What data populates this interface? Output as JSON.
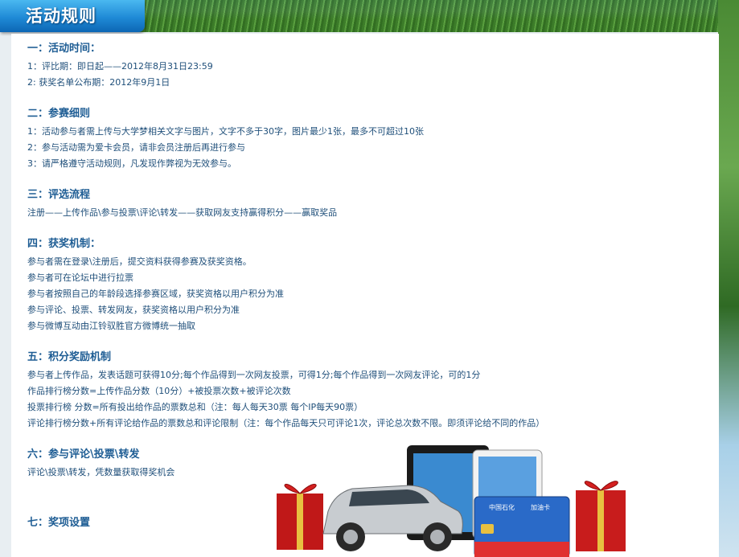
{
  "header": {
    "title": "活动规则"
  },
  "sections": [
    {
      "heading": "一：活动时间：",
      "lines": [
        "1：评比期：即日起——2012年8月31日23:59",
        "2: 获奖名单公布期：2012年9月1日"
      ]
    },
    {
      "heading": "二：参赛细则",
      "lines": [
        "1：活动参与者需上传与大学梦相关文字与图片，文字不多于30字，图片最少1张，最多不可超过10张",
        "2：参与活动需为爱卡会员，请非会员注册后再进行参与",
        "3：请严格遵守活动规则，凡发现作弊视为无效参与。"
      ]
    },
    {
      "heading": "三：评选流程",
      "lines": [
        "注册——上传作品\\参与投票\\评论\\转发——获取网友支持赢得积分——赢取奖品"
      ]
    },
    {
      "heading": "四：获奖机制：",
      "lines": [
        "参与者需在登录\\注册后，提交资料获得参赛及获奖资格。",
        "参与者可在论坛中进行拉票",
        "参与者按照自己的年龄段选择参赛区域，获奖资格以用户积分为准",
        "参与评论、投票、转发网友，获奖资格以用户积分为准",
        "参与微博互动由江铃驭胜官方微博统一抽取"
      ]
    },
    {
      "heading": "五：积分奖励机制",
      "lines": [
        "参与者上传作品，发表话题可获得10分;每个作品得到一次网友投票，可得1分;每个作品得到一次网友评论，可的1分",
        "作品排行榜分数=上传作品分数（10分）+被投票次数+被评论次数",
        "投票排行榜 分数=所有投出给作品的票数总和（注：每人每天30票 每个IP每天90票）",
        "评论排行榜分数+所有评论给作品的票数总和评论限制（注：每个作品每天只可评论1次，评论总次数不限。即须评论给不同的作品）"
      ]
    },
    {
      "heading": "六：参与评论\\投票\\转发",
      "lines": [
        "评论\\投票\\转发，凭数量获取得奖机会"
      ]
    },
    {
      "heading": "七：奖项设置",
      "lines": []
    }
  ],
  "promo": {
    "card_brand": "中国石化",
    "card_label": "加油卡"
  },
  "colors": {
    "heading": "#1e5d94",
    "text": "#1f4f7a",
    "tab": "#1f8ad6"
  }
}
